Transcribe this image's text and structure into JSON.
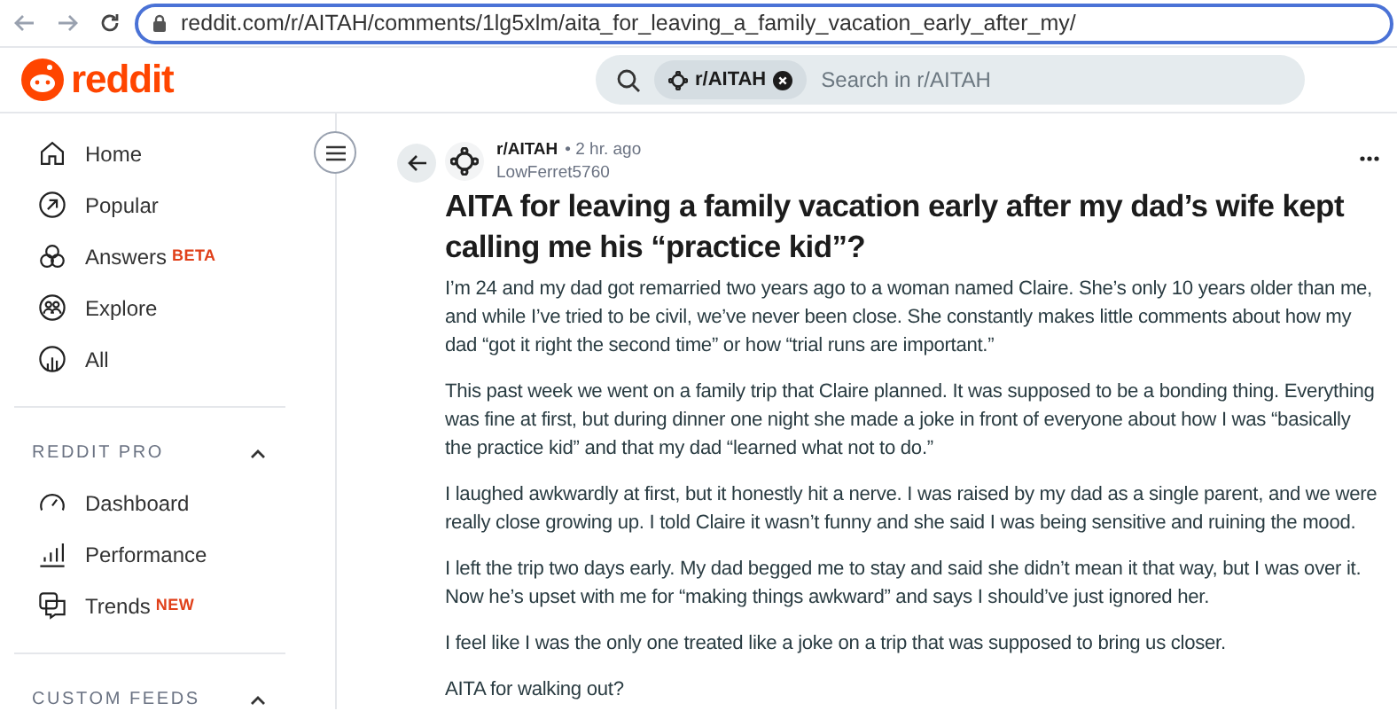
{
  "browser": {
    "url": "reddit.com/r/AITAH/comments/1lg5xlm/aita_for_leaving_a_family_vacation_early_after_my/"
  },
  "header": {
    "logo": "reddit",
    "search": {
      "chip": "r/AITAH",
      "placeholder": "Search in r/AITAH"
    }
  },
  "sidebar": {
    "items": [
      {
        "label": "Home"
      },
      {
        "label": "Popular"
      },
      {
        "label": "Answers",
        "badge": "BETA"
      },
      {
        "label": "Explore"
      },
      {
        "label": "All"
      }
    ],
    "sections": [
      {
        "title": "REDDIT PRO",
        "expanded": true,
        "items": [
          {
            "label": "Dashboard"
          },
          {
            "label": "Performance"
          },
          {
            "label": "Trends",
            "badge": "NEW"
          }
        ]
      },
      {
        "title": "CUSTOM FEEDS",
        "expanded": true
      }
    ]
  },
  "post": {
    "subreddit": "r/AITAH",
    "time": "• 2 hr. ago",
    "author": "LowFerret5760",
    "title": "AITA for leaving a family vacation early after my dad’s wife kept calling me his “practice kid”?",
    "paragraphs": [
      "I’m 24 and my dad got remarried two years ago to a woman named Claire. She’s only 10 years older than me, and while I’ve tried to be civil, we’ve never been close. She constantly makes little comments about how my dad “got it right the second time” or how “trial runs are important.”",
      "This past week we went on a family trip that Claire planned. It was supposed to be a bonding thing. Everything was fine at first, but during dinner one night she made a joke in front of everyone about how I was “basically the practice kid” and that my dad “learned what not to do.”",
      "I laughed awkwardly at first, but it honestly hit a nerve. I was raised by my dad as a single parent, and we were really close growing up. I told Claire it wasn’t funny and she said I was being sensitive and ruining the mood.",
      "I left the trip two days early. My dad begged me to stay and said she didn’t mean it that way, but I was over it. Now he’s upset with me for “making things awkward” and says I should’ve just ignored her.",
      "I feel like I was the only one treated like a joke on a trip that was supposed to bring us closer.",
      "AITA for walking out?"
    ]
  }
}
